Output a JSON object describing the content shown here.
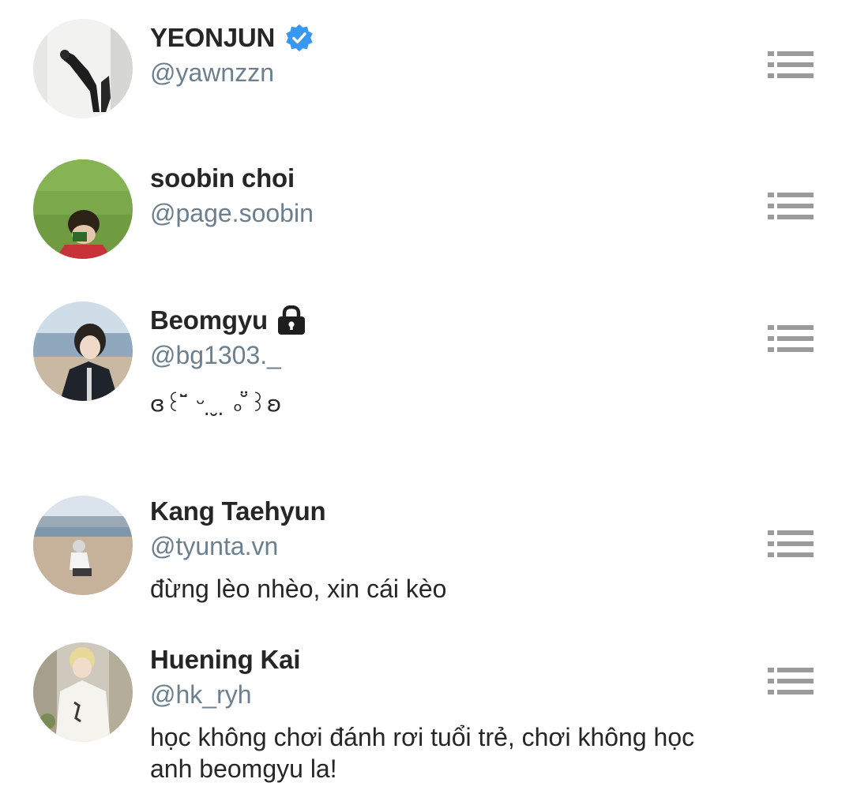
{
  "accent_verified": "#3897f0",
  "menu_icon_color": "#9a9a9a",
  "users": [
    {
      "display_name": "YEONJUN",
      "handle": "@yawnzzn",
      "badge": "verified-icon",
      "bio": "",
      "menu_icon": "list-icon"
    },
    {
      "display_name": "soobin choi",
      "handle": "@page.soobin",
      "badge": "",
      "bio": "",
      "menu_icon": "list-icon"
    },
    {
      "display_name": "Beomgyu",
      "handle": "@bg1303._",
      "badge": "lock-icon",
      "bio": "ɞ꒰ ̆̈ ᵕ ̣ ̮ ̣ ₒ ̆̈꒱ʚ",
      "menu_icon": "list-icon"
    },
    {
      "display_name": "Kang Taehyun",
      "handle": "@tyunta.vn",
      "badge": "",
      "bio": "đừng lèo nhèo, xin cái kèo",
      "menu_icon": "list-icon"
    },
    {
      "display_name": "Huening Kai",
      "handle": "@hk_ryh",
      "badge": "",
      "bio": "học không chơi đánh rơi tuổi trẻ, chơi không học anh beomgyu la!",
      "menu_icon": "list-icon"
    }
  ]
}
